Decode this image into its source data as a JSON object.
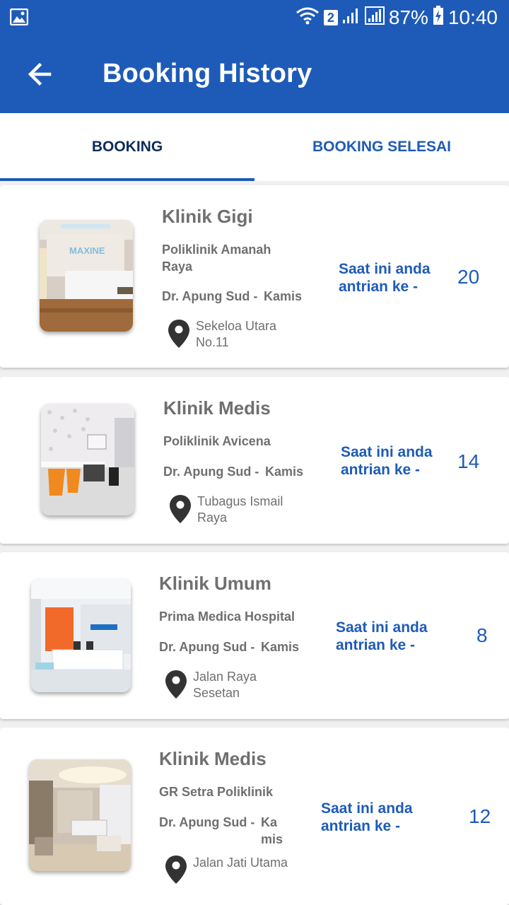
{
  "status_bar": {
    "sim_badge": "2",
    "battery": "87%",
    "time": "10:40"
  },
  "app_bar": {
    "title": "Booking History",
    "back_icon": "arrow-left-icon"
  },
  "tabs": [
    {
      "label": "BOOKING",
      "active": true
    },
    {
      "label": "BOOKING SELESAI",
      "active": false
    }
  ],
  "bookings": [
    {
      "clinic": "Klinik Gigi",
      "polyclinic": "Poliklinik Amanah Raya",
      "doctor": "Dr. Apung Sud -",
      "day": "Kamis",
      "address": "Sekeloa Utara No.11",
      "queue_label": "Saat ini anda antrian ke -",
      "queue_number": "20"
    },
    {
      "clinic": "Klinik Medis",
      "polyclinic": "Poliklinik Avicena",
      "doctor": "Dr. Apung Sud -",
      "day": "Kamis",
      "address": "Tubagus Ismail Raya",
      "queue_label": "Saat ini anda antrian ke -",
      "queue_number": "14"
    },
    {
      "clinic": "Klinik Umum",
      "polyclinic": "Prima Medica Hospital",
      "doctor": "Dr. Apung Sud -",
      "day": "Kamis",
      "address": "Jalan Raya Sesetan",
      "queue_label": "Saat ini anda antrian ke -",
      "queue_number": "8"
    },
    {
      "clinic": "Klinik Medis",
      "polyclinic": "GR Setra Poliklinik",
      "doctor": "Dr. Apung Sud -",
      "day": "Ka mis",
      "address": "Jalan Jati Utama",
      "queue_label": "Saat ini anda antrian ke -",
      "queue_number": "12"
    }
  ],
  "colors": {
    "primary": "#1e5bb8",
    "tab_active_text": "#0d2c5a",
    "muted_text": "#6f6f6f"
  }
}
